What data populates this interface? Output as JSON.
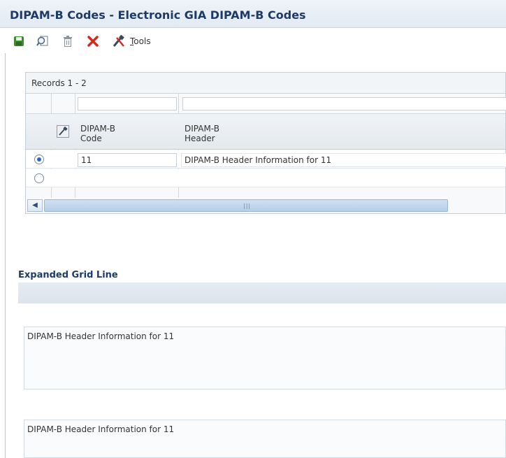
{
  "window": {
    "title": "DIPAM-B Codes - Electronic GIA DIPAM-B Codes"
  },
  "toolbar": {
    "icons": [
      "save-icon",
      "find-icon",
      "delete-icon",
      "cancel-icon",
      "tools-icon"
    ],
    "tools_prefix": "T",
    "tools_rest": "ools"
  },
  "grid": {
    "records_label": "Records 1 - 2",
    "columns": [
      {
        "line1": "DIPAM-B",
        "line2": "Code"
      },
      {
        "line1": "DIPAM-B",
        "line2": "Header"
      }
    ],
    "rows": [
      {
        "selected": true,
        "code": "11",
        "header": "DIPAM-B Header Information for 11"
      },
      {
        "selected": false,
        "code": "",
        "header": ""
      }
    ],
    "scroll_grip": "|||"
  },
  "expanded": {
    "title": "Expanded Grid Line",
    "field1": "DIPAM-B Header Information for 11",
    "field2": "DIPAM-B Header Information for 11"
  },
  "colors": {
    "title": "#1e3a66",
    "accent": "#2a6ab4",
    "cancel": "#d42a1c",
    "save": "#3f8a2f"
  }
}
